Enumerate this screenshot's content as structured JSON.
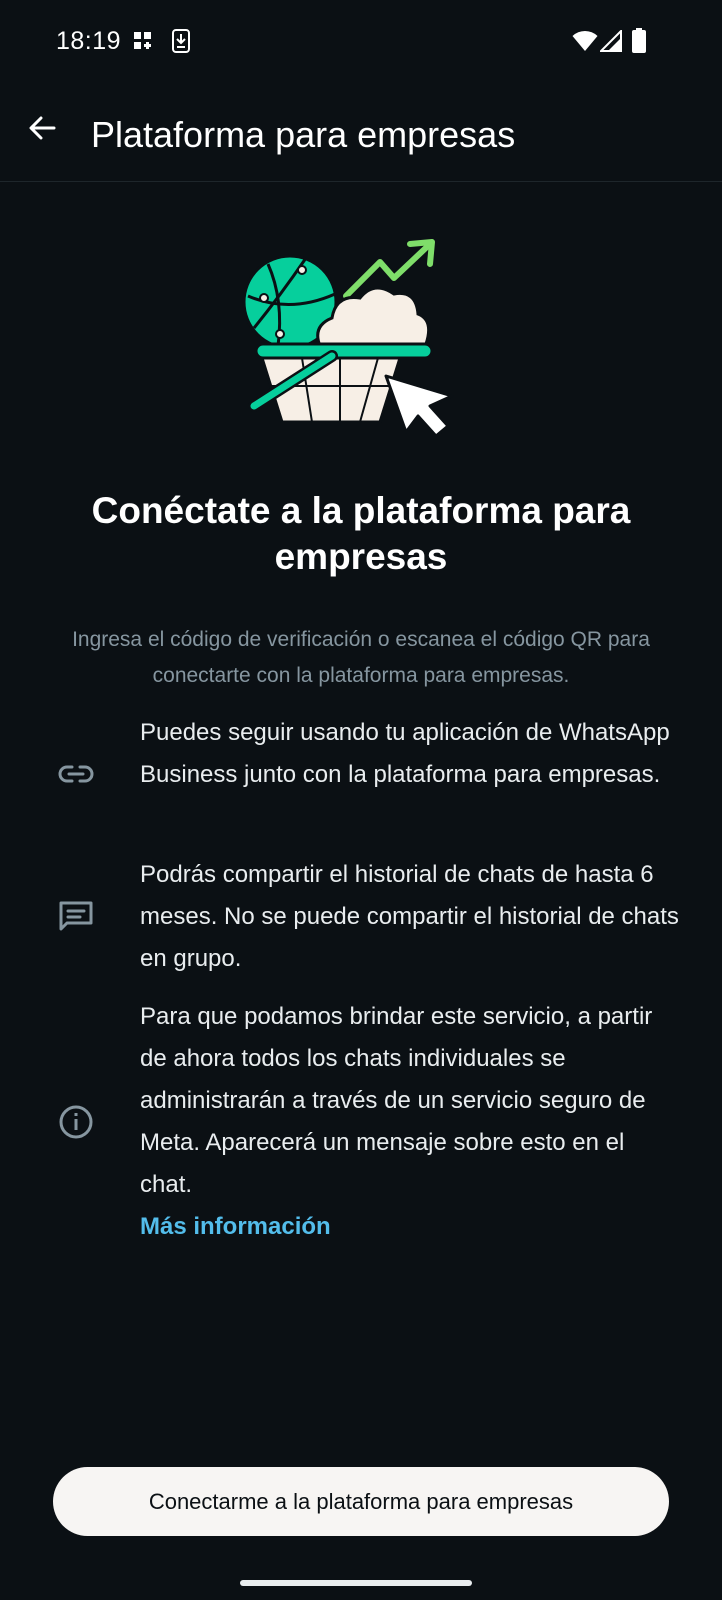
{
  "status_bar": {
    "time": "18:19",
    "icons": [
      "grid-notification-icon",
      "download-notification-icon",
      "wifi-icon",
      "signal-icon",
      "battery-icon"
    ]
  },
  "app_bar": {
    "title": "Plataforma para empresas",
    "back_icon": "arrow-back-icon"
  },
  "hero": {
    "illustration": "globe-cloud-basket-illustration",
    "colors": {
      "green": "#06cf9c",
      "lime": "#7fde6a",
      "cream": "#f7efe6"
    }
  },
  "main": {
    "heading": "Conéctate a la plataforma para empresas",
    "subtext": "Ingresa el código de verificación o escanea el código QR para conectarte con la plataforma para empresas.",
    "items": [
      {
        "icon": "link-icon",
        "text": "Puedes seguir usando tu aplicación de WhatsApp Business junto con la plataforma para empresas."
      },
      {
        "icon": "chat-history-icon",
        "text": "Podrás compartir el historial de chats de hasta 6 meses. No se puede compartir el historial de chats en grupo."
      },
      {
        "icon": "info-icon",
        "text": "Para que podamos brindar este servicio, a partir de ahora todos los chats individuales se administrarán a través de un servicio seguro de Meta. Aparecerá un mensaje sobre esto en el chat.",
        "link": "Más información"
      }
    ]
  },
  "footer": {
    "connect_button": "Conectarme a la plataforma para empresas"
  },
  "colors": {
    "background": "#0b1014",
    "link": "#53bdeb",
    "secondary_text": "#8696a0",
    "button_bg": "#f7f5f3"
  }
}
